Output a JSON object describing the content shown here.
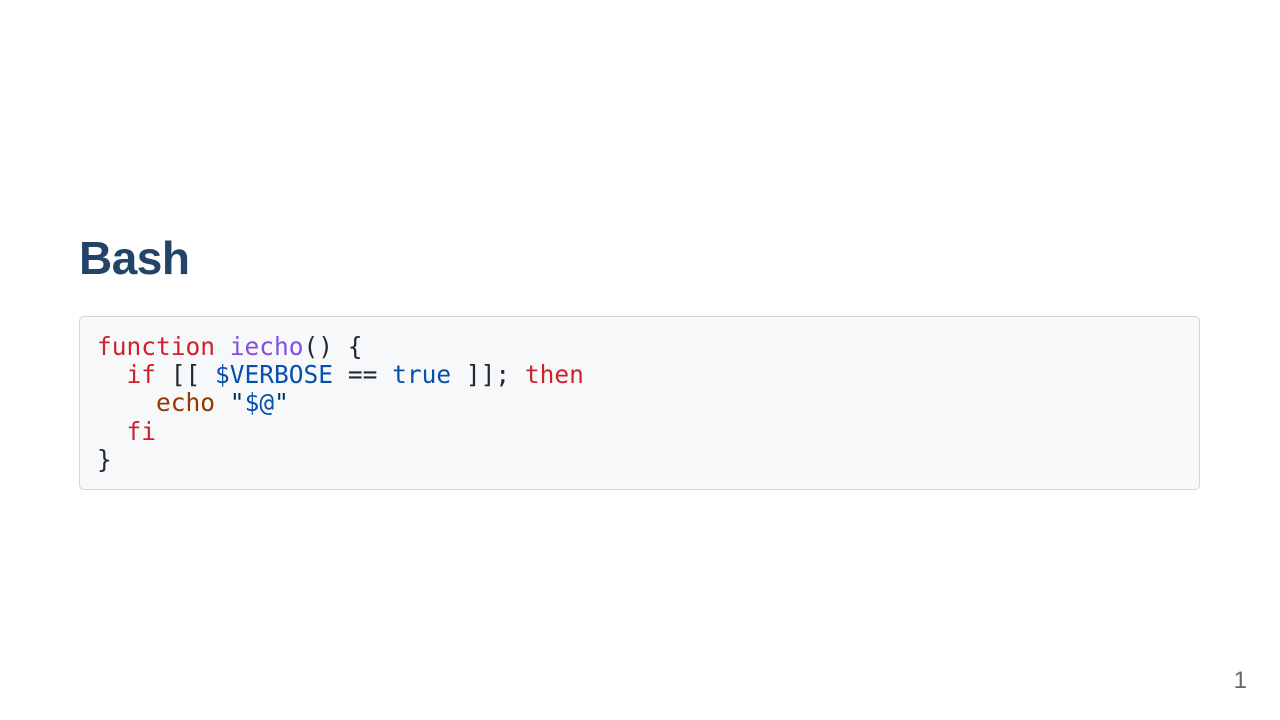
{
  "slide": {
    "title": "Bash",
    "page_number": "1"
  },
  "code": {
    "language": "bash",
    "colors": {
      "keyword": "#cf222e",
      "function": "#8250df",
      "variable": "#0550ae",
      "builtin": "#953800",
      "string": "#0a3069",
      "text": "#24292f",
      "background": "#f6f8fa",
      "title": "#224466"
    },
    "line1": {
      "kw": "function",
      "fn": "iecho",
      "rest": "() {"
    },
    "line2": {
      "indent": "  ",
      "kw_if": "if",
      "open": " [[ ",
      "var": "$VERBOSE",
      "op": " == ",
      "bool": "true",
      "close": " ]]; ",
      "kw_then": "then"
    },
    "line3": {
      "indent": "    ",
      "builtin": "echo",
      "space": " ",
      "q1": "\"",
      "arg": "$@",
      "q2": "\""
    },
    "line4": {
      "indent": "  ",
      "kw": "fi"
    },
    "line5": {
      "text": "}"
    }
  }
}
